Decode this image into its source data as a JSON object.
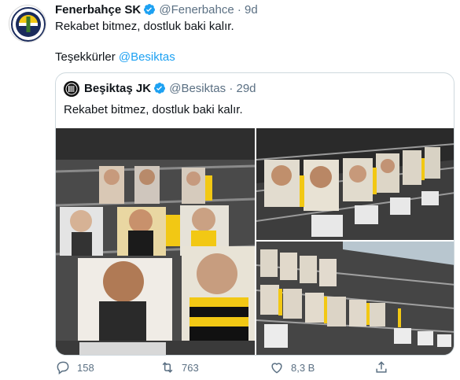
{
  "tweet": {
    "author_name": "Fenerbahçe SK",
    "author_handle": "@Fenerbahce",
    "separator": "·",
    "time": "9d",
    "line1": "Rekabet bitmez, dostluk baki kalır.",
    "line2_prefix": "Teşekkürler ",
    "line2_mention": "@Besiktas"
  },
  "quoted": {
    "author_name": "Beşiktaş JK",
    "author_handle": "@Besiktas",
    "separator": "·",
    "time": "29d",
    "text": "Rekabet bitmez, dostluk baki kalır."
  },
  "actions": {
    "reply_count": "158",
    "retweet_count": "763",
    "like_count": "8,3 B",
    "icons": [
      "reply-icon",
      "retweet-icon",
      "like-icon",
      "share-icon"
    ]
  },
  "colors": {
    "text": "#0f1419",
    "secondary": "#5b7083",
    "link": "#1da1f2",
    "verified": "#1da1f2",
    "border": "#cfd9de",
    "stadium_yellow": "#f2c814",
    "seat_dark": "#2b2b2b"
  }
}
